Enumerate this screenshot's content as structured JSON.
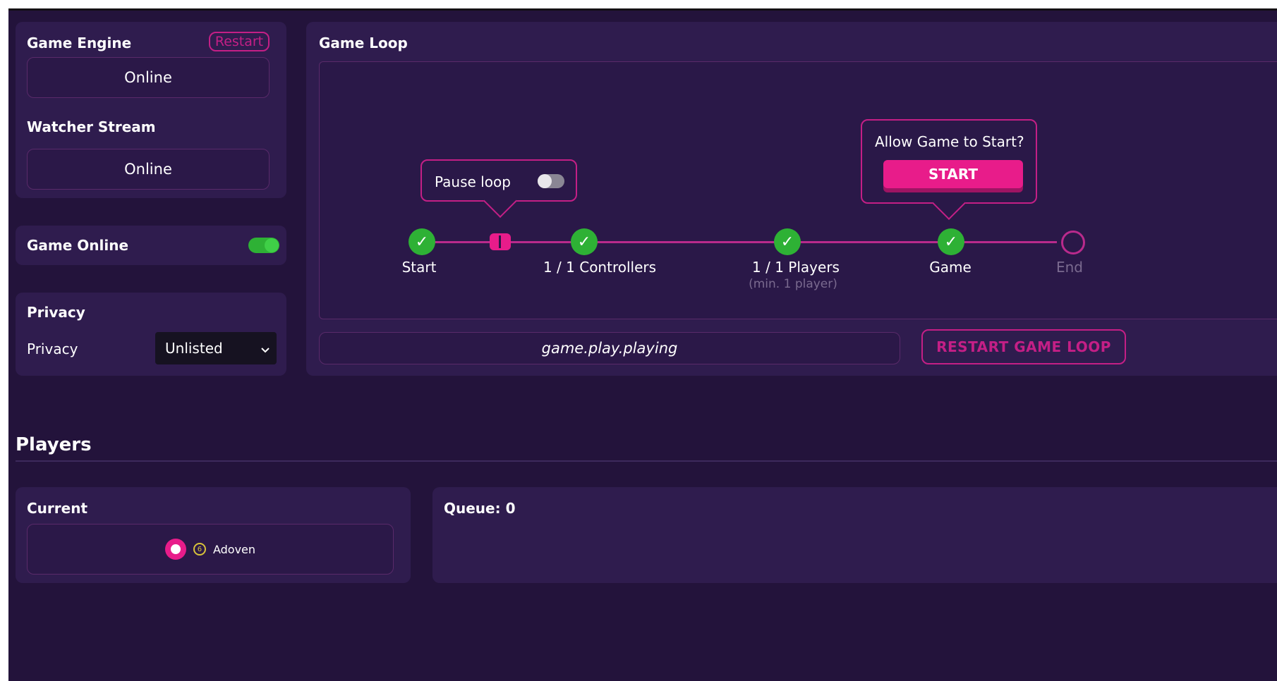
{
  "engine_panel": {
    "title": "Game Engine",
    "restart_label": "Restart",
    "engine_status": "Online",
    "stream_title": "Watcher Stream",
    "stream_status": "Online"
  },
  "game_online": {
    "label": "Game Online",
    "enabled": true
  },
  "privacy": {
    "title": "Privacy",
    "label": "Privacy",
    "selected": "Unlisted"
  },
  "game_loop": {
    "title": "Game Loop",
    "pause_popup": {
      "label": "Pause loop",
      "enabled": false
    },
    "start_popup": {
      "question": "Allow Game to Start?",
      "button_label": "START"
    },
    "steps": [
      {
        "label": "Start",
        "sublabel": "",
        "done": true
      },
      {
        "label": "1 / 1 Controllers",
        "sublabel": "",
        "done": true
      },
      {
        "label": "1 / 1 Players",
        "sublabel": "(min. 1 player)",
        "done": true
      },
      {
        "label": "Game",
        "sublabel": "",
        "done": true
      },
      {
        "label": "End",
        "sublabel": "",
        "done": false
      }
    ],
    "state_text": "game.play.playing",
    "restart_loop_label": "RESTART GAME LOOP"
  },
  "players": {
    "heading": "Players",
    "current_title": "Current",
    "current_player": {
      "badge": "6",
      "name": "Adoven"
    },
    "queue_title": "Queue: 0"
  },
  "colors": {
    "background": "#23133b",
    "panel": "#2f1c4e",
    "accent": "#e81c8a",
    "success": "#2eb135"
  }
}
